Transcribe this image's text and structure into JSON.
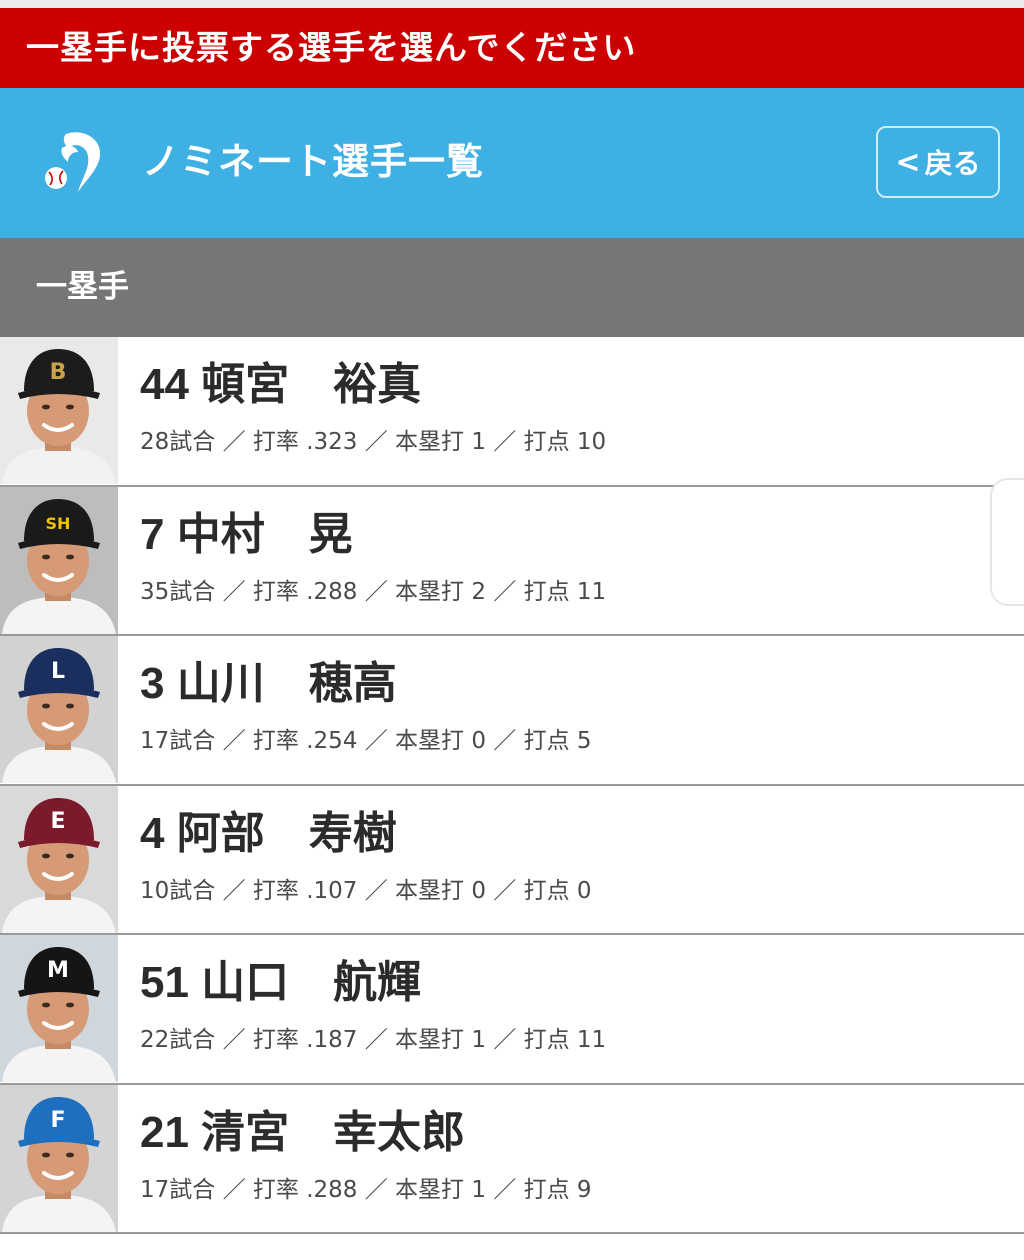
{
  "banner": {
    "text": "一塁手に投票する選手を選んでください"
  },
  "nav": {
    "title": "ノミネート選手一覧",
    "back_label": "戻る",
    "back_icon": "chevron-left-icon",
    "logo_icon": "baseball-logo-icon"
  },
  "section": {
    "title": "一塁手"
  },
  "players": [
    {
      "name": "44 頓宮　裕真",
      "stats": "28試合 ／ 打率 .323 ／ 本塁打 1 ／ 打点 10",
      "cap_color": "#1c1c1c",
      "cap_logo": "B",
      "logo_color": "#c8a24a",
      "uniform_color": "#f2f2f2",
      "bg_color": "#e9e9e9"
    },
    {
      "name": "7 中村　晃",
      "stats": "35試合 ／ 打率 .288 ／ 本塁打 2 ／ 打点 11",
      "cap_color": "#1a1a1a",
      "cap_logo": "SH",
      "logo_color": "#f2c200",
      "uniform_color": "#f4f4f4",
      "bg_color": "#bdbdbd"
    },
    {
      "name": "3 山川　穂高",
      "stats": "17試合 ／ 打率 .254 ／ 本塁打 0 ／ 打点 5",
      "cap_color": "#1b2f5e",
      "cap_logo": "L",
      "logo_color": "#ffffff",
      "uniform_color": "#f4f4f4",
      "bg_color": "#d2d2d2"
    },
    {
      "name": "4 阿部　寿樹",
      "stats": "10試合 ／ 打率 .107 ／ 本塁打 0 ／ 打点 0",
      "cap_color": "#7a1a2a",
      "cap_logo": "E",
      "logo_color": "#ffffff",
      "uniform_color": "#f4f4f4",
      "bg_color": "#d9d9d9"
    },
    {
      "name": "51 山口　航輝",
      "stats": "22試合 ／ 打率 .187 ／ 本塁打 1 ／ 打点 11",
      "cap_color": "#151515",
      "cap_logo": "M",
      "logo_color": "#ffffff",
      "uniform_color": "#f4f4f4",
      "bg_color": "#cfd6dc"
    },
    {
      "name": "21 清宮　幸太郎",
      "stats": "17試合 ／ 打率 .288 ／ 本塁打 1 ／ 打点 9",
      "cap_color": "#1e6fc0",
      "cap_logo": "F",
      "logo_color": "#ffffff",
      "uniform_color": "#f4f4f4",
      "bg_color": "#d4d4d4"
    }
  ]
}
